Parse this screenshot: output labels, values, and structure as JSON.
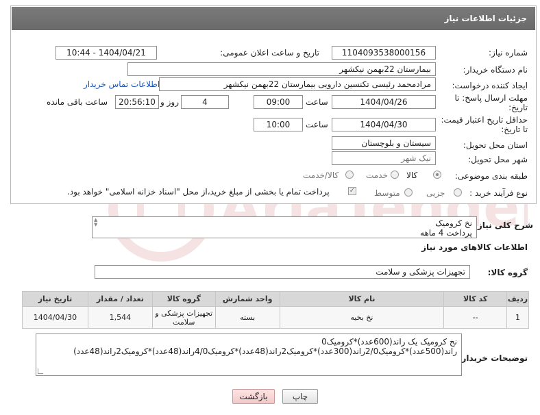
{
  "header": {
    "title": "جزئیات اطلاعات نیاز"
  },
  "need_number": {
    "label": "شماره نیاز:",
    "value": "1104093538000156"
  },
  "announce_date": {
    "label": "تاریخ و ساعت اعلان عمومی:",
    "value": "1404/04/21 - 10:44"
  },
  "buyer_org": {
    "label": "نام دستگاه خریدار:",
    "value": "بیمارستان 22بهمن نیکشهر"
  },
  "creator": {
    "label": "ایجاد کننده درخواست:",
    "value": "مرادمحمد رئیسی تکنسین دارویی بیمارستان 22بهمن نیکشهر",
    "contact_link": "اطلاعات تماس خریدار"
  },
  "reply_deadline": {
    "label_line1": "مهلت ارسال پاسخ: تا",
    "label_line2": "تاریخ:",
    "date": "1404/04/26",
    "time_label": "ساعت",
    "time": "09:00",
    "days": "4",
    "days_label": "روز و",
    "remaining": "20:56:10",
    "remaining_label": "ساعت باقی مانده"
  },
  "price_validity": {
    "label_line1": "حداقل تاریخ اعتبار قیمت:",
    "label_line2": "تا تاریخ:",
    "date": "1404/04/30",
    "time_label": "ساعت",
    "time": "10:00"
  },
  "province": {
    "label": "استان محل تحویل:",
    "value": "سیستان و بلوچستان"
  },
  "city": {
    "label": "شهر محل تحویل:",
    "value": "نیک شهر"
  },
  "category": {
    "label": "طبقه بندی موضوعی:",
    "options": [
      "کالا",
      "خدمت",
      "کالا/خدمت"
    ],
    "selected": "کالا"
  },
  "purchase_type": {
    "label": "نوع فرآیند خرید :",
    "options": [
      "جزیی",
      "متوسط"
    ],
    "note": "پرداخت تمام یا بخشی از مبلغ خرید،از محل \"اسناد خزانه اسلامی\" خواهد بود."
  },
  "description": {
    "label": "شرح کلی نیاز:",
    "line1": "نخ کرومیک",
    "line2": "پرداخت 4 ماهه"
  },
  "goods_info": {
    "title": "اطلاعات کالاهای مورد نیاز"
  },
  "goods_group": {
    "label": "گروه کالا:",
    "value": "تجهیزات پزشکی و سلامت"
  },
  "table": {
    "headers": [
      "ردیف",
      "کد کالا",
      "نام کالا",
      "واحد شمارش",
      "گروه کالا",
      "تعداد / مقدار",
      "تاریخ نیاز"
    ],
    "rows": [
      [
        "1",
        "--",
        "نخ بخیه",
        "بسته",
        "تجهیزات پزشکی و سلامت",
        "1,544",
        "1404/04/30"
      ]
    ]
  },
  "buyer_notes": {
    "label": "توضیحات خریدار:",
    "line1": "نخ کرومیک یک راند(600عدد)*کرومیک0",
    "line2": "راند(500عدد)*کرومیک2/0راند(300عدد)*کرومیک2راند(48عدد)*کرومیک4/0راند(48عدد)*کرومیک2راند(48عدد)"
  },
  "buttons": {
    "print": "چاپ",
    "back": "بازگشت"
  },
  "watermark": "AriaTender.net",
  "colors": {
    "header_bg": "#737373",
    "link": "#1a56b8",
    "back_button": "#f2c9c9"
  }
}
